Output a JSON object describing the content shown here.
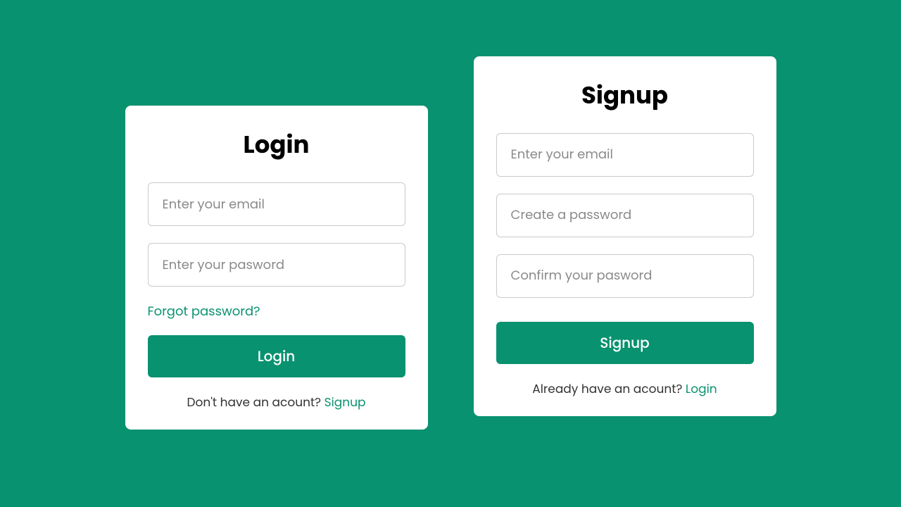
{
  "accent": "#09926f",
  "login": {
    "title": "Login",
    "email_placeholder": "Enter your email",
    "password_placeholder": "Enter your pasword",
    "forgot": "Forgot password?",
    "submit": "Login",
    "footer_text": "Don't have an acount? ",
    "footer_link": "Signup"
  },
  "signup": {
    "title": "Signup",
    "email_placeholder": "Enter your email",
    "password_placeholder": "Create a password",
    "confirm_placeholder": "Confirm your pasword",
    "submit": "Signup",
    "footer_text": "Already have an acount? ",
    "footer_link": "Login"
  }
}
